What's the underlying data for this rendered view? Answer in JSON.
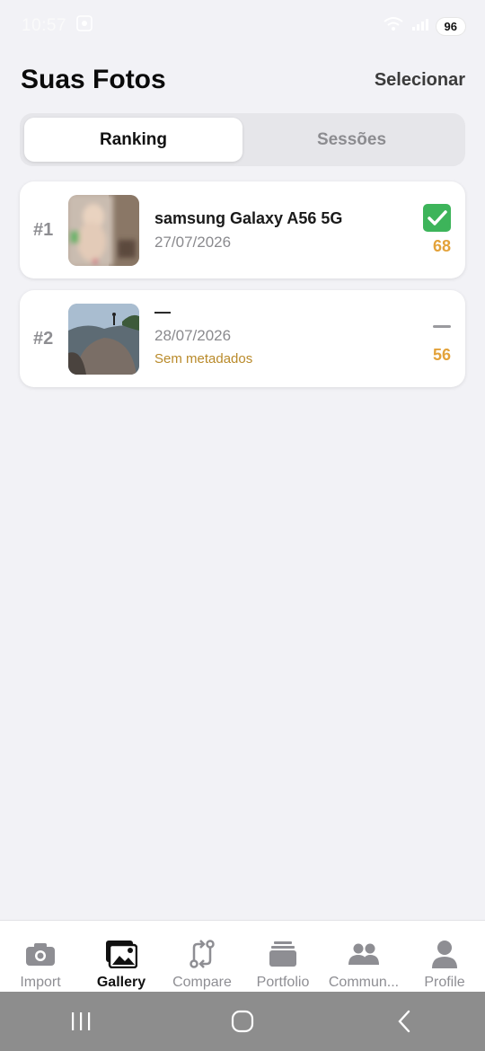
{
  "status_bar": {
    "time": "10:57",
    "battery": "96"
  },
  "header": {
    "title": "Suas Fotos",
    "select_label": "Selecionar"
  },
  "segments": [
    {
      "label": "Ranking",
      "active": true
    },
    {
      "label": "Sessões",
      "active": false
    }
  ],
  "photos": [
    {
      "rank": "#1",
      "title": "samsung Galaxy A56 5G",
      "date": "27/07/2026",
      "meta": "",
      "status_icon": "check-icon",
      "score": "68"
    },
    {
      "rank": "#2",
      "title": "—",
      "date": "28/07/2026",
      "meta": "Sem metadados",
      "status_icon": "dash-icon",
      "score": "56"
    }
  ],
  "tabs": [
    {
      "label": "Import",
      "icon": "camera-icon",
      "active": false
    },
    {
      "label": "Gallery",
      "icon": "gallery-icon",
      "active": true
    },
    {
      "label": "Compare",
      "icon": "compare-icon",
      "active": false
    },
    {
      "label": "Portfolio",
      "icon": "portfolio-icon",
      "active": false
    },
    {
      "label": "Commun...",
      "icon": "community-icon",
      "active": false
    },
    {
      "label": "Profile",
      "icon": "profile-icon",
      "active": false
    }
  ],
  "colors": {
    "accent_score": "#e3a23a",
    "meta_warning": "#b98a2a",
    "check_green": "#3db45a",
    "background": "#f2f2f6"
  }
}
